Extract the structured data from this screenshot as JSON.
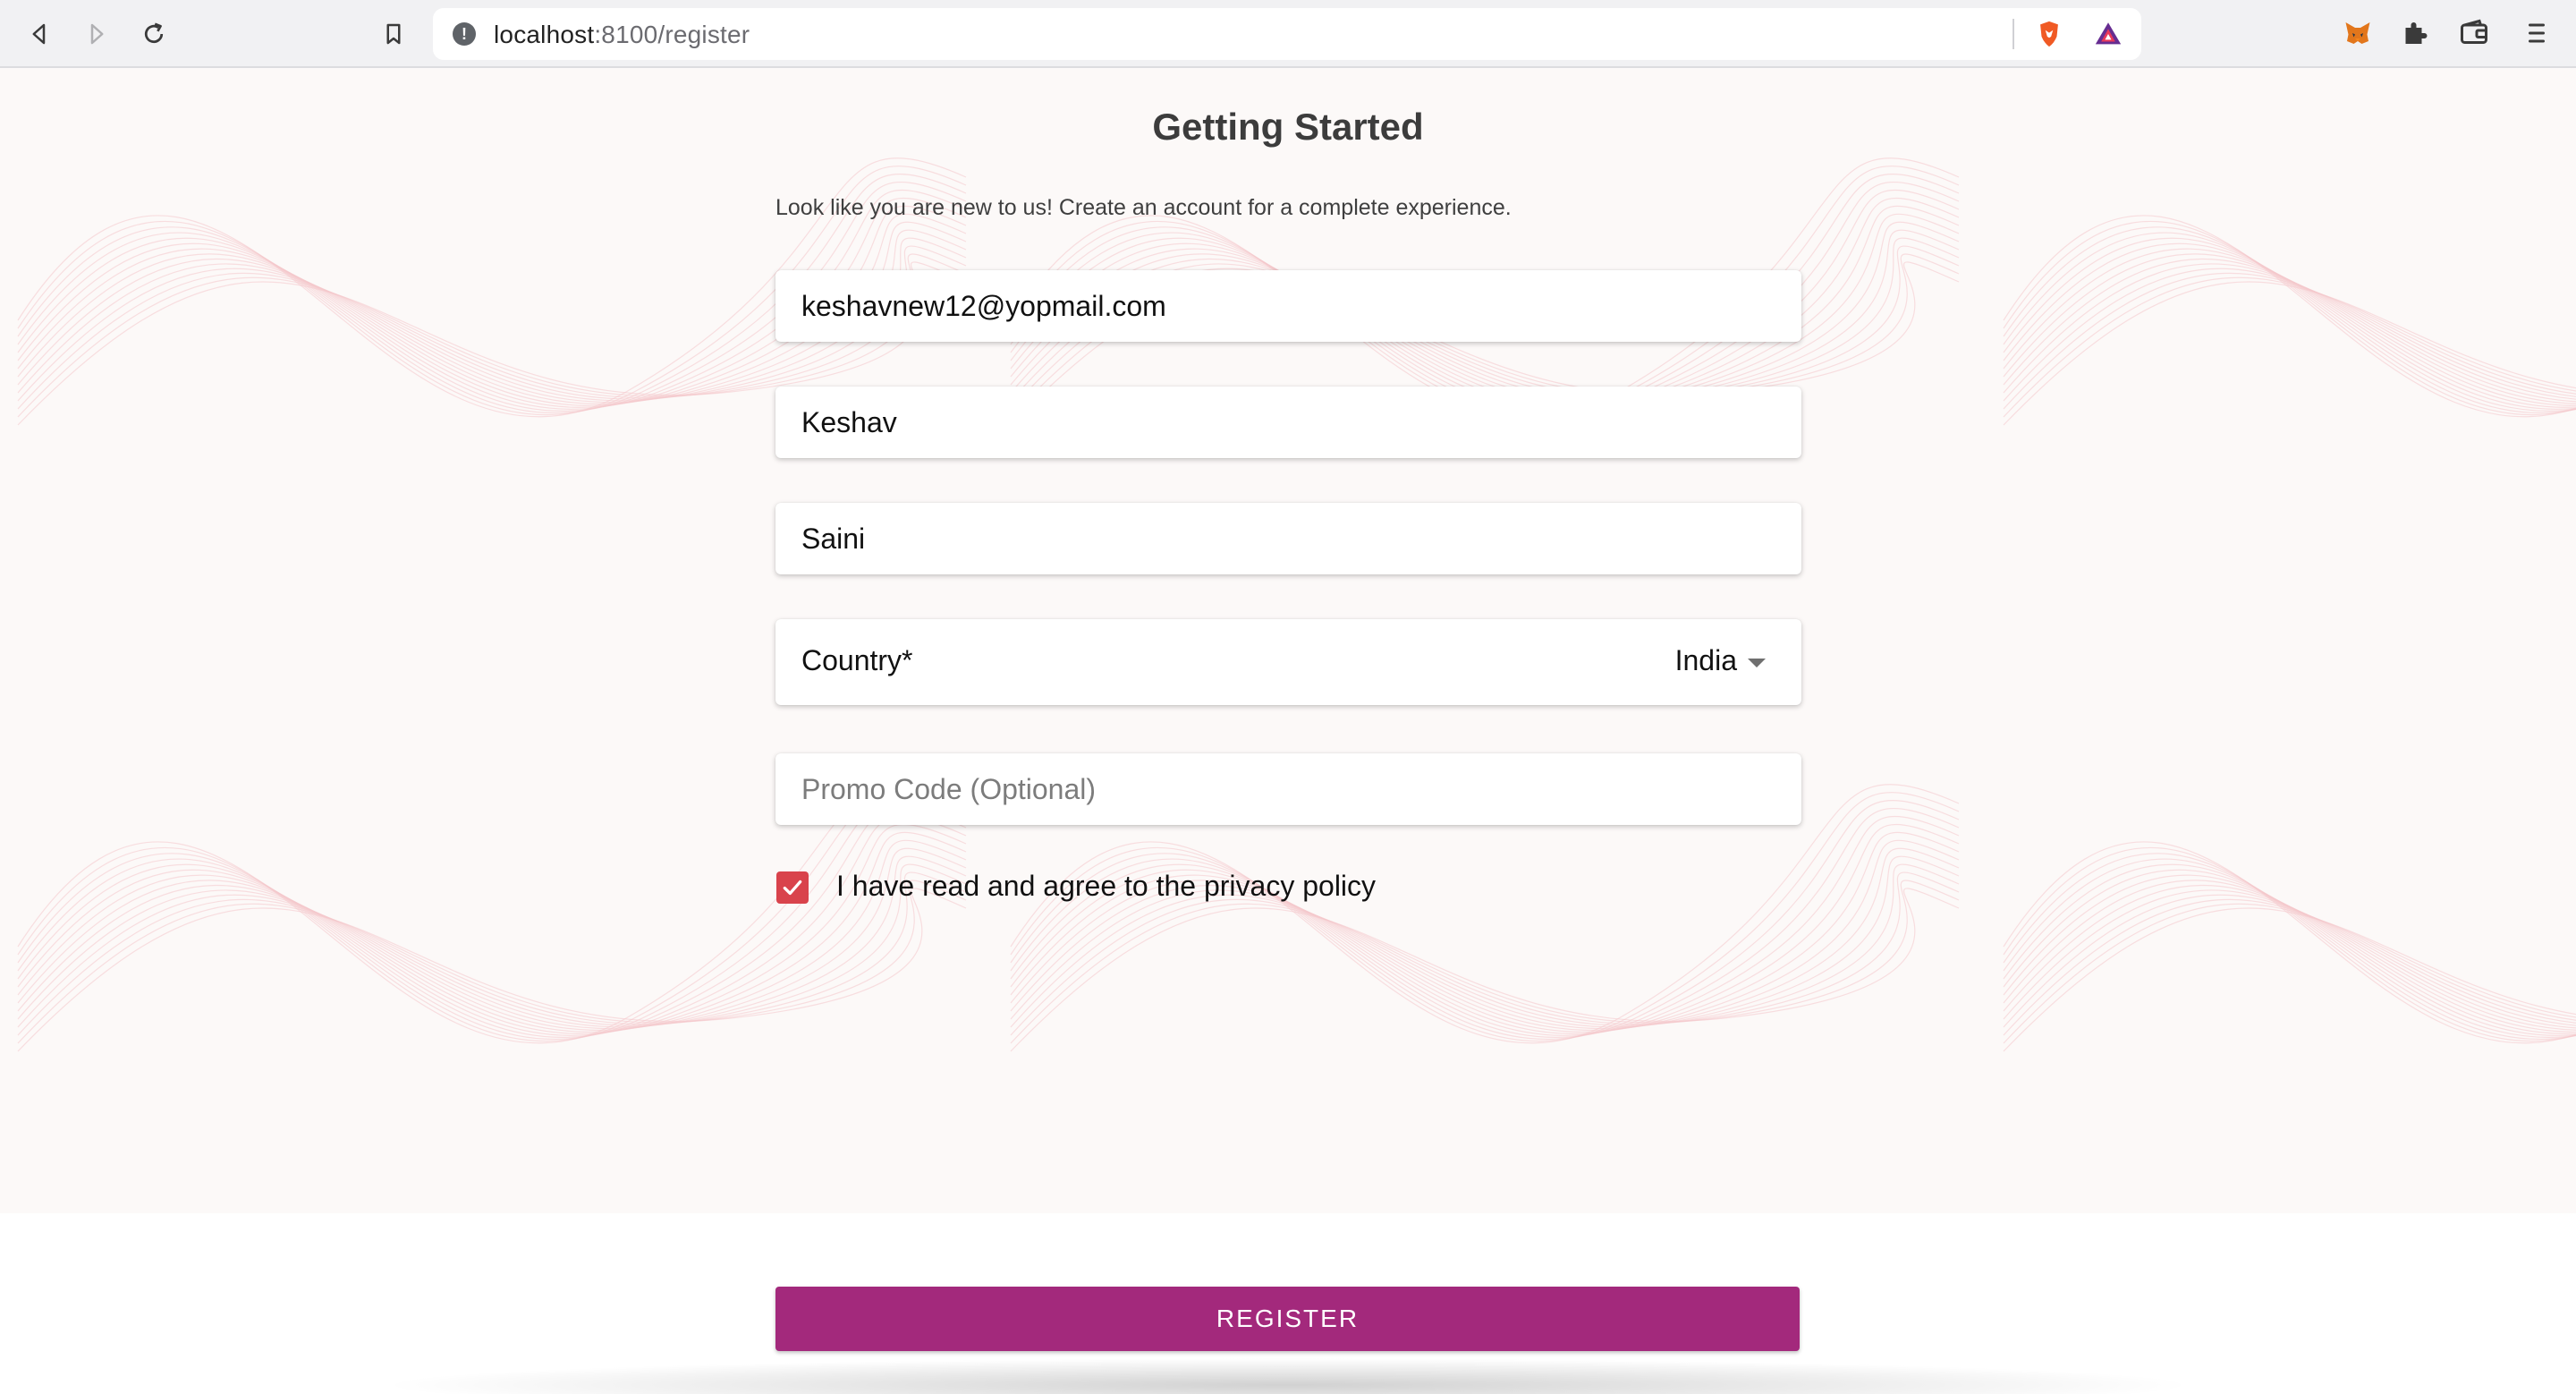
{
  "browser": {
    "url_host": "localhost",
    "url_path": ":8100/register",
    "icons": [
      "back-icon",
      "forward-icon",
      "reload-icon",
      "bookmark-icon",
      "site-info-icon",
      "brave-shields-icon",
      "brave-rewards-icon",
      "metamask-icon",
      "extensions-icon",
      "wallet-icon",
      "menu-icon"
    ]
  },
  "form": {
    "title": "Getting Started",
    "subtitle": "Look like you are new to us! Create an account for a complete experience.",
    "email_value": "keshavnew12@yopmail.com",
    "first_name_value": "Keshav",
    "last_name_value": "Saini",
    "country_label": "Country*",
    "country_value": "India",
    "promo_placeholder": "Promo Code (Optional)",
    "privacy_label": "I have read and agree to the privacy policy",
    "privacy_checked": true,
    "register_label": "REGISTER"
  },
  "colors": {
    "accent": "#a3297c",
    "checkbox": "#d9434c",
    "background": "#fcf9f8"
  }
}
